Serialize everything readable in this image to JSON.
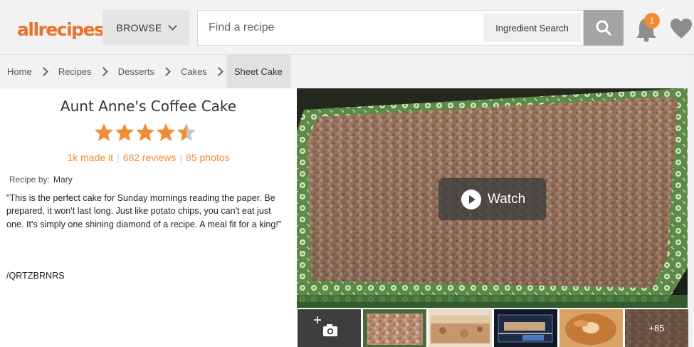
{
  "header": {
    "logo_text": "allrecipes",
    "browse_label": "BROWSE",
    "search_placeholder": "Find a recipe",
    "ingredient_search_label": "Ingredient Search",
    "notification_count": "1",
    "brand_color": "#e8722c"
  },
  "breadcrumb": [
    {
      "label": "Home"
    },
    {
      "label": "Recipes"
    },
    {
      "label": "Desserts"
    },
    {
      "label": "Cakes"
    },
    {
      "label": "Sheet Cake"
    }
  ],
  "recipe": {
    "title": "Aunt Anne's Coffee Cake",
    "rating": 4.5,
    "made_it": "1k made it",
    "reviews": "682 reviews",
    "photos": "85 photos",
    "recipe_by_label": "Recipe by:",
    "author": "Mary",
    "description": "\"This is the perfect cake for Sunday mornings reading the paper. Be prepared, it won't last long. Just like potato chips, you can't eat just one. It's simply one shining diamond of a recipe. A meal fit for a king!\"",
    "code": "/QRTZBRNRS"
  },
  "media": {
    "watch_label": "Watch",
    "more_photos_label": "+85",
    "accent_color": "#f18b35"
  }
}
